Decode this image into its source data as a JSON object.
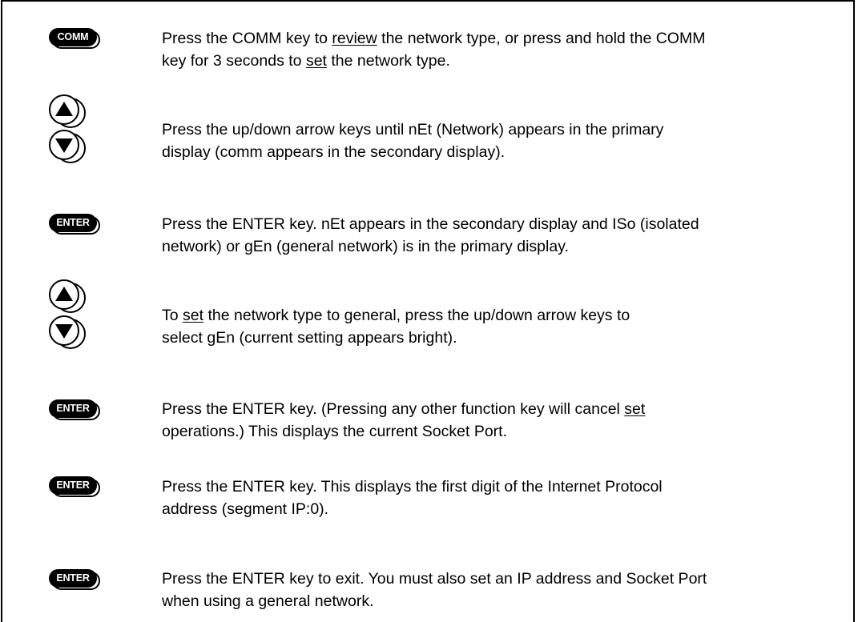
{
  "keys": {
    "comm": "COMM",
    "enter": "ENTER"
  },
  "icons": {
    "up": "up-arrow-key-icon",
    "down": "down-arrow-key-icon"
  },
  "steps": [
    {
      "lines": [
        [
          "Press the COMM key to ",
          "review",
          " the network type, or press and hold the COMM"
        ],
        [
          "key for 3 seconds to ",
          "set",
          " the network type."
        ]
      ]
    },
    {
      "lines": [
        "Press the up/down arrow keys until nEt (Network) appears in the primary",
        "display (comm appears in the secondary display)."
      ]
    },
    {
      "lines": [
        "Press the ENTER key. nEt appears in the secondary display and ISo (isolated",
        "network) or gEn (general network) is in the primary display."
      ]
    },
    {
      "lines": [
        [
          "To ",
          "set",
          " the network type to general, press the up/down arrow keys to"
        ],
        "select gEn (current setting appears bright)."
      ]
    },
    {
      "lines": [
        [
          "Press the ENTER key. (Pressing any other function key will cancel ",
          "set"
        ],
        "operations.) This displays the current Socket Port."
      ]
    },
    {
      "lines": [
        "Press the ENTER key. This displays the first digit of the Internet Protocol",
        "address (segment IP:0)."
      ]
    },
    {
      "lines": [
        "Press the ENTER key to exit. You must also set an IP address and Socket Port",
        "when using a general network."
      ]
    }
  ]
}
